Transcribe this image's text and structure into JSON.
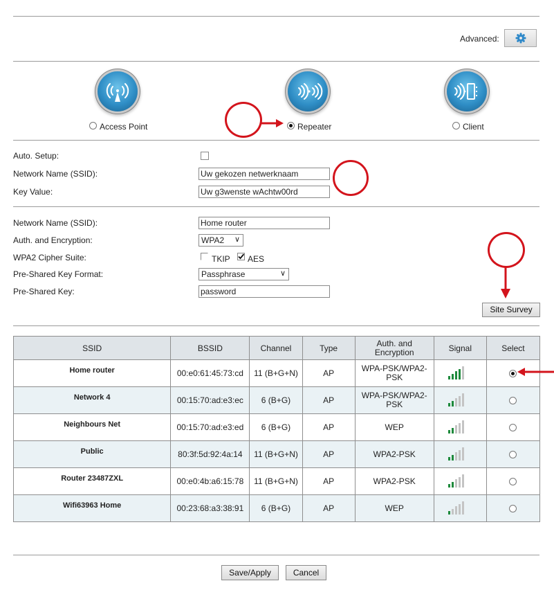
{
  "header": {
    "advanced_label": "Advanced:",
    "advanced_icon": "gear-icon"
  },
  "modes": [
    {
      "label": "Access Point",
      "icon": "access-point-icon",
      "selected": false
    },
    {
      "label": "Repeater",
      "icon": "repeater-icon",
      "selected": true
    },
    {
      "label": "Client",
      "icon": "client-icon",
      "selected": false
    }
  ],
  "repeater_settings": {
    "auto_setup_label": "Auto. Setup:",
    "auto_setup_checked": false,
    "ssid_label": "Network Name (SSID):",
    "ssid_value": "Uw gekozen netwerknaam",
    "key_label": "Key Value:",
    "key_value": "Uw g3wenste wAchtw00rd"
  },
  "uplink_settings": {
    "ssid_label": "Network Name (SSID):",
    "ssid_value": "Home router",
    "auth_label": "Auth. and Encryption:",
    "auth_value": "WPA2",
    "cipher_label": "WPA2 Cipher Suite:",
    "cipher_tkip_label": "TKIP",
    "cipher_tkip_checked": false,
    "cipher_aes_label": "AES",
    "cipher_aes_checked": true,
    "psk_format_label": "Pre-Shared Key Format:",
    "psk_format_value": "Passphrase",
    "psk_label": "Pre-Shared Key:",
    "psk_value": "password",
    "site_survey_label": "Site Survey"
  },
  "survey_table": {
    "columns": [
      "SSID",
      "BSSID",
      "Channel",
      "Type",
      "Auth. and Encryption",
      "Signal",
      "Select"
    ],
    "signal_max_bars": 5,
    "signal_color_on": "#1e8a3c",
    "signal_color_off": "#c4c4c4",
    "rows": [
      {
        "ssid": "Home router",
        "bssid": "00:e0:61:45:73:cd",
        "channel": "11 (B+G+N)",
        "type": "AP",
        "auth": "WPA-PSK/WPA2-PSK",
        "signal_bars": 4,
        "selected": true
      },
      {
        "ssid": "Network 4",
        "bssid": "00:15:70:ad:e3:ec",
        "channel": "6 (B+G)",
        "type": "AP",
        "auth": "WPA-PSK/WPA2-PSK",
        "signal_bars": 2,
        "selected": false
      },
      {
        "ssid": "Neighbours Net",
        "bssid": "00:15:70:ad:e3:ed",
        "channel": "6 (B+G)",
        "type": "AP",
        "auth": "WEP",
        "signal_bars": 2,
        "selected": false
      },
      {
        "ssid": "Public",
        "bssid": "80:3f:5d:92:4a:14",
        "channel": "11 (B+G+N)",
        "type": "AP",
        "auth": "WPA2-PSK",
        "signal_bars": 2,
        "selected": false
      },
      {
        "ssid": "Router 23487ZXL",
        "bssid": "00:e0:4b:a6:15:78",
        "channel": "11 (B+G+N)",
        "type": "AP",
        "auth": "WPA2-PSK",
        "signal_bars": 2,
        "selected": false
      },
      {
        "ssid": "Wifi63963 Home",
        "bssid": "00:23:68:a3:38:91",
        "channel": "6 (B+G)",
        "type": "AP",
        "auth": "WEP",
        "signal_bars": 1,
        "selected": false
      }
    ]
  },
  "footer": {
    "save_label": "Save/Apply",
    "cancel_label": "Cancel"
  },
  "annotation_color": "#d3141c"
}
